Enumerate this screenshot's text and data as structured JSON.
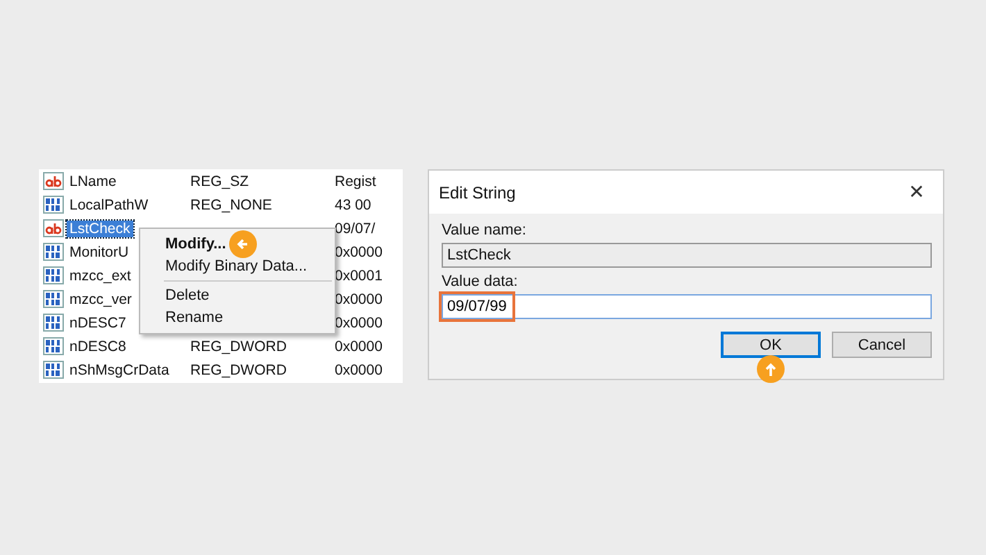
{
  "registry_list": {
    "rows": [
      {
        "kind": "string",
        "name": "LName",
        "type": "REG_SZ",
        "data": "Regist",
        "selected": false
      },
      {
        "kind": "binary",
        "name": "LocalPathW",
        "type": "REG_NONE",
        "data": "43 00",
        "selected": false
      },
      {
        "kind": "string",
        "name": "LstCheck",
        "data": "09/07/",
        "selected": true
      },
      {
        "kind": "binary",
        "name": "MonitorU",
        "data": "0x0000",
        "selected": false
      },
      {
        "kind": "binary",
        "name": "mzcc_ext",
        "data": "0x0001",
        "selected": false
      },
      {
        "kind": "binary",
        "name": "mzcc_ver",
        "data": "0x0000",
        "selected": false
      },
      {
        "kind": "binary",
        "name": "nDESC7",
        "data": "0x0000",
        "selected": false
      },
      {
        "kind": "binary",
        "name": "nDESC8",
        "type": "REG_DWORD",
        "data": "0x0000",
        "selected": false
      },
      {
        "kind": "binary",
        "name": "nShMsgCrData",
        "type": "REG_DWORD",
        "data": "0x0000",
        "selected": false
      }
    ]
  },
  "context_menu": {
    "items": [
      {
        "kind": "item",
        "label": "Modify...",
        "bold": true,
        "pointer": true
      },
      {
        "kind": "item",
        "label": "Modify Binary Data...",
        "bold": false,
        "pointer": false
      },
      {
        "kind": "separator"
      },
      {
        "kind": "item",
        "label": "Delete",
        "bold": false,
        "pointer": false
      },
      {
        "kind": "item",
        "label": "Rename",
        "bold": false,
        "pointer": false
      }
    ]
  },
  "dialog": {
    "title": "Edit String",
    "close": "✕",
    "value_name_label": "Value name:",
    "value_name": "LstCheck",
    "value_data_label": "Value data:",
    "value_data": "09/07/99",
    "buttons": [
      {
        "label": "OK",
        "focused": true,
        "pointer": true
      },
      {
        "label": "Cancel",
        "focused": false,
        "pointer": false
      }
    ]
  }
}
